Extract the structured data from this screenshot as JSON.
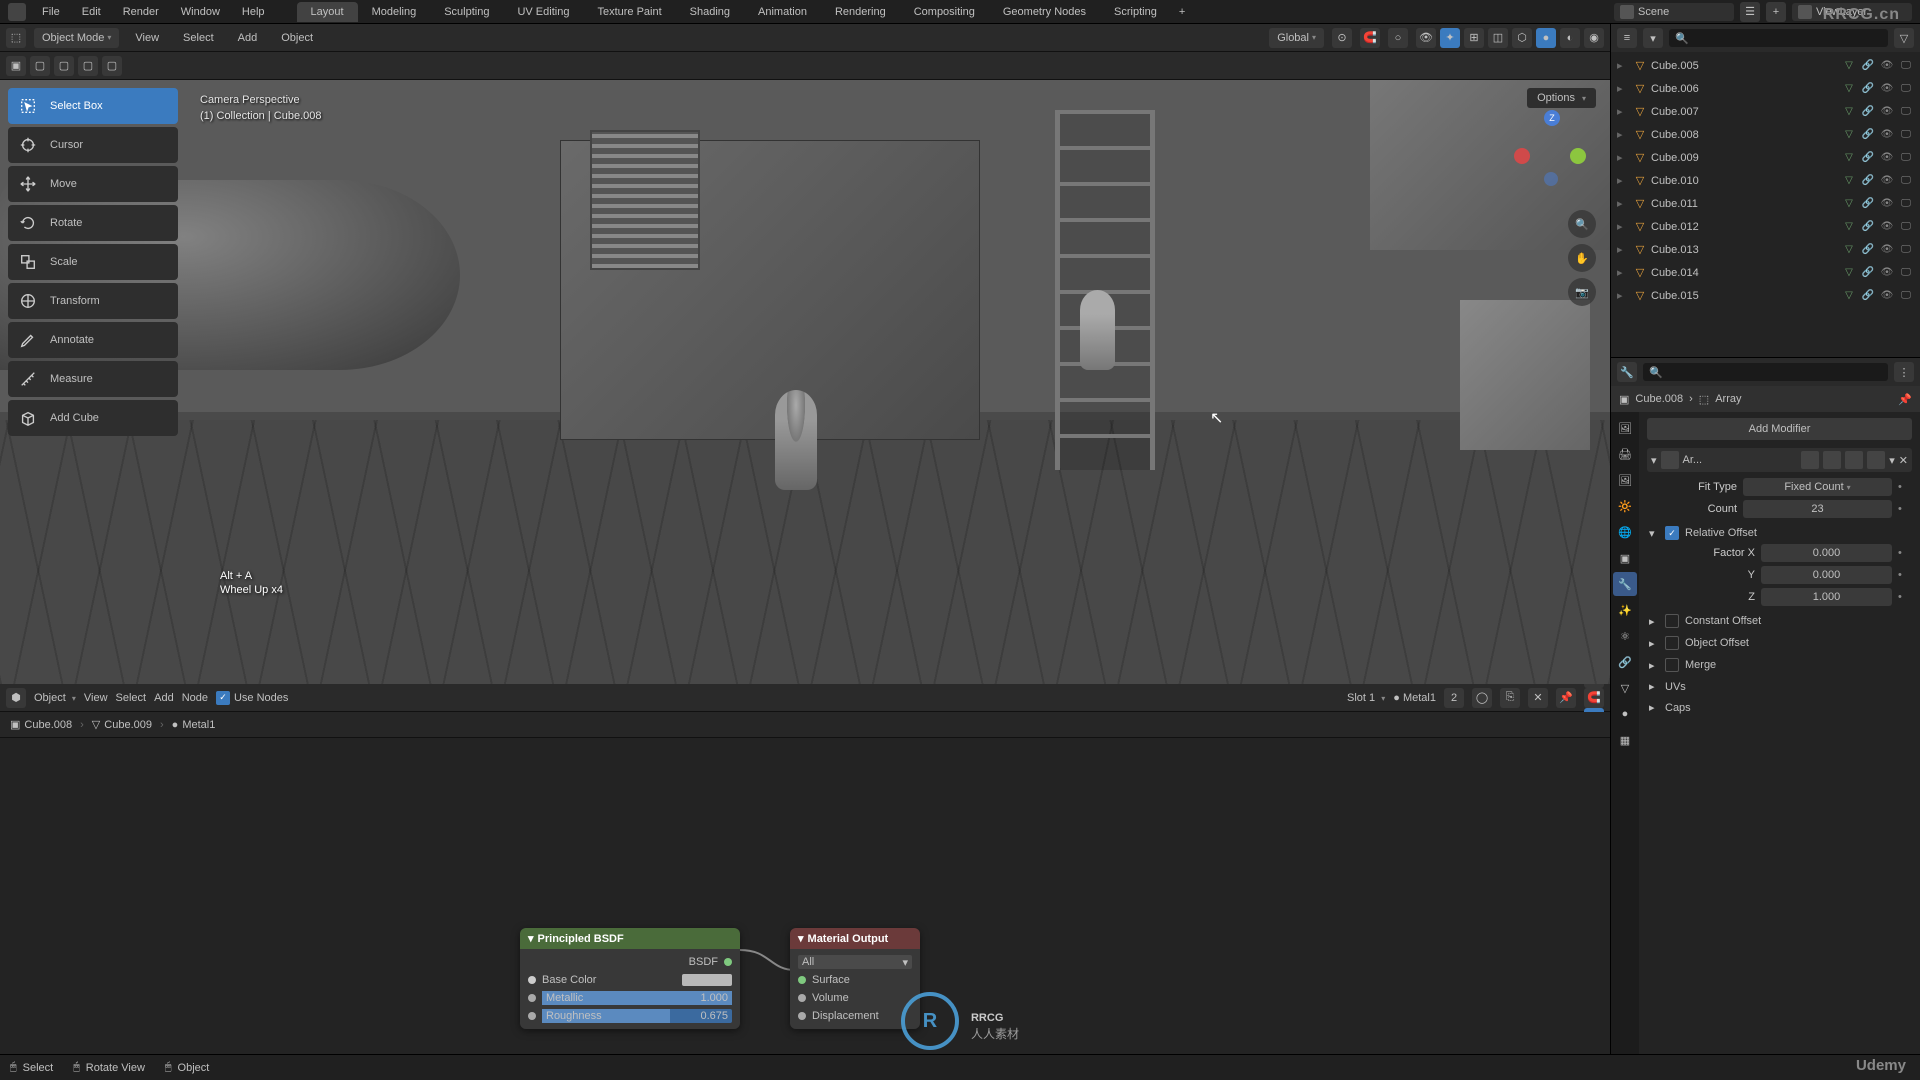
{
  "menubar": {
    "items": [
      "File",
      "Edit",
      "Render",
      "Window",
      "Help"
    ],
    "tabs": [
      "Layout",
      "Modeling",
      "Sculpting",
      "UV Editing",
      "Texture Paint",
      "Shading",
      "Animation",
      "Rendering",
      "Compositing",
      "Geometry Nodes",
      "Scripting"
    ],
    "active_tab": "Layout",
    "scene_label": "Scene",
    "layer_label": "ViewLayer"
  },
  "viewport": {
    "mode": "Object Mode",
    "hdr": [
      "View",
      "Select",
      "Add",
      "Object"
    ],
    "orientation": "Global",
    "info_line1": "Camera Perspective",
    "info_line2": "(1) Collection | Cube.008",
    "key_line1": "Alt + A",
    "key_line2": "Wheel Up x4",
    "options": "Options"
  },
  "tools": [
    {
      "name": "select-box",
      "label": "Select Box",
      "active": true
    },
    {
      "name": "cursor",
      "label": "Cursor"
    },
    {
      "name": "move",
      "label": "Move"
    },
    {
      "name": "rotate",
      "label": "Rotate"
    },
    {
      "name": "scale",
      "label": "Scale"
    },
    {
      "name": "transform",
      "label": "Transform"
    },
    {
      "name": "annotate",
      "label": "Annotate"
    },
    {
      "name": "measure",
      "label": "Measure"
    },
    {
      "name": "add-cube",
      "label": "Add Cube"
    }
  ],
  "node_editor": {
    "hdr_mode": "Object",
    "hdr_items": [
      "View",
      "Select",
      "Add",
      "Node"
    ],
    "use_nodes": "Use Nodes",
    "slot": "Slot 1",
    "material": "Metal1",
    "users": "2",
    "breadcrumb": [
      "Cube.008",
      "Cube.009",
      "Metal1"
    ],
    "bsdf": {
      "title": "Principled BSDF",
      "out": "BSDF",
      "base_color": "Base Color",
      "metallic": {
        "label": "Metallic",
        "value": "1.000"
      },
      "roughness": {
        "label": "Roughness",
        "value": "0.675"
      }
    },
    "output": {
      "title": "Material Output",
      "target": "All",
      "sockets": [
        "Surface",
        "Volume",
        "Displacement"
      ]
    }
  },
  "outliner": {
    "items": [
      "Cube.005",
      "Cube.006",
      "Cube.007",
      "Cube.008",
      "Cube.009",
      "Cube.010",
      "Cube.011",
      "Cube.012",
      "Cube.013",
      "Cube.014",
      "Cube.015"
    ]
  },
  "properties": {
    "breadcrumb_obj": "Cube.008",
    "breadcrumb_mod": "Array",
    "add_modifier": "Add Modifier",
    "mod_name": "Ar...",
    "fit_type_label": "Fit Type",
    "fit_type": "Fixed Count",
    "count_label": "Count",
    "count": "23",
    "relative_offset": "Relative Offset",
    "factor_x": {
      "label": "Factor X",
      "value": "0.000"
    },
    "factor_y": {
      "label": "Y",
      "value": "0.000"
    },
    "factor_z": {
      "label": "Z",
      "value": "1.000"
    },
    "panels": [
      "Constant Offset",
      "Object Offset",
      "Merge",
      "UVs",
      "Caps"
    ]
  },
  "statusbar": {
    "select": "Select",
    "rotate": "Rotate View",
    "object": "Object"
  },
  "watermarks": {
    "tr": "RRCG.cn",
    "br": "Udemy",
    "center": "RRCG",
    "center_sub": "人人素材"
  }
}
